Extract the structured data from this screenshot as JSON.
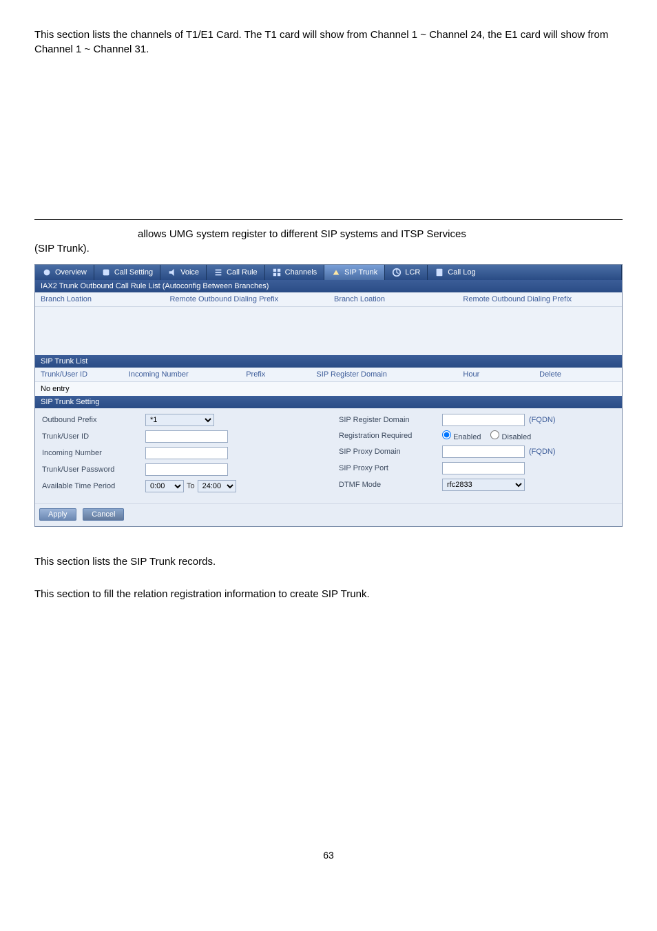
{
  "intro_para": "This section lists the channels of T1/E1 Card. The T1 card will show from Channel 1 ~ Channel 24, the E1 card will show from Channel 1 ~ Channel 31.",
  "mid_para": {
    "tail": "allows UMG system register to different SIP systems and ITSP Services",
    "tail2": "(SIP Trunk)."
  },
  "tabs": {
    "items": [
      {
        "label": "Overview",
        "icon": "overview-icon"
      },
      {
        "label": "Call Setting",
        "icon": "call-setting-icon"
      },
      {
        "label": "Voice",
        "icon": "voice-icon"
      },
      {
        "label": "Call Rule",
        "icon": "call-rule-icon"
      },
      {
        "label": "Channels",
        "icon": "channels-icon"
      },
      {
        "label": "SIP Trunk",
        "icon": "sip-trunk-icon"
      },
      {
        "label": "LCR",
        "icon": "lcr-icon"
      },
      {
        "label": "Call Log",
        "icon": "call-log-icon"
      }
    ],
    "active": "SIP Trunk"
  },
  "iax2": {
    "title": "IAX2 Trunk Outbound Call Rule List (Autoconfig Between Branches)",
    "cols": [
      "Branch Loation",
      "Remote Outbound Dialing Prefix",
      "Branch Loation",
      "Remote Outbound Dialing Prefix"
    ]
  },
  "sip_list": {
    "title": "SIP Trunk List",
    "cols": [
      "Trunk/User ID",
      "Incoming Number",
      "Prefix",
      "SIP Register Domain",
      "Hour",
      "Delete"
    ],
    "empty_text": "No entry"
  },
  "sip_setting": {
    "title": "SIP Trunk Setting",
    "left": {
      "outbound_prefix_label": "Outbound Prefix",
      "outbound_prefix_value": "*1",
      "trunk_user_id_label": "Trunk/User ID",
      "trunk_user_id_value": "",
      "incoming_number_label": "Incoming Number",
      "incoming_number_value": "",
      "trunk_user_password_label": "Trunk/User Password",
      "trunk_user_password_value": "",
      "available_time_label": "Available Time Period",
      "time_from": "0:00",
      "time_to_label": "To",
      "time_to": "24:00"
    },
    "right": {
      "sip_register_domain_label": "SIP Register Domain",
      "sip_register_domain_value": "",
      "fqdn": "(FQDN)",
      "registration_required_label": "Registration Required",
      "registration_enabled": "Enabled",
      "registration_disabled": "Disabled",
      "sip_proxy_domain_label": "SIP Proxy Domain",
      "sip_proxy_domain_value": "",
      "sip_proxy_port_label": "SIP Proxy Port",
      "sip_proxy_port_value": "",
      "dtmf_label": "DTMF Mode",
      "dtmf_value": "rfc2833"
    },
    "buttons": {
      "apply": "Apply",
      "cancel": "Cancel"
    }
  },
  "body_text": {
    "p1": "This section lists the SIP Trunk records.",
    "p2": "This section to fill the relation registration information to create SIP Trunk."
  },
  "page_num": "63"
}
